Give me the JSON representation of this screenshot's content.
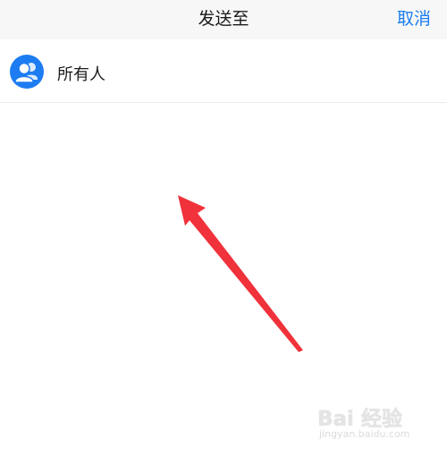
{
  "header": {
    "title": "发送至",
    "cancel_label": "取消"
  },
  "recipients": [
    {
      "label": "所有人",
      "icon": "group-icon"
    }
  ],
  "annotation": {
    "arrow_color": "#f0323a"
  },
  "watermark": {
    "brand": "Bai 经验",
    "url": "jingyan.baidu.com"
  },
  "colors": {
    "accent": "#1a7ef0",
    "avatar": "#1d7cf2",
    "nav_background": "#f7f7f7"
  }
}
